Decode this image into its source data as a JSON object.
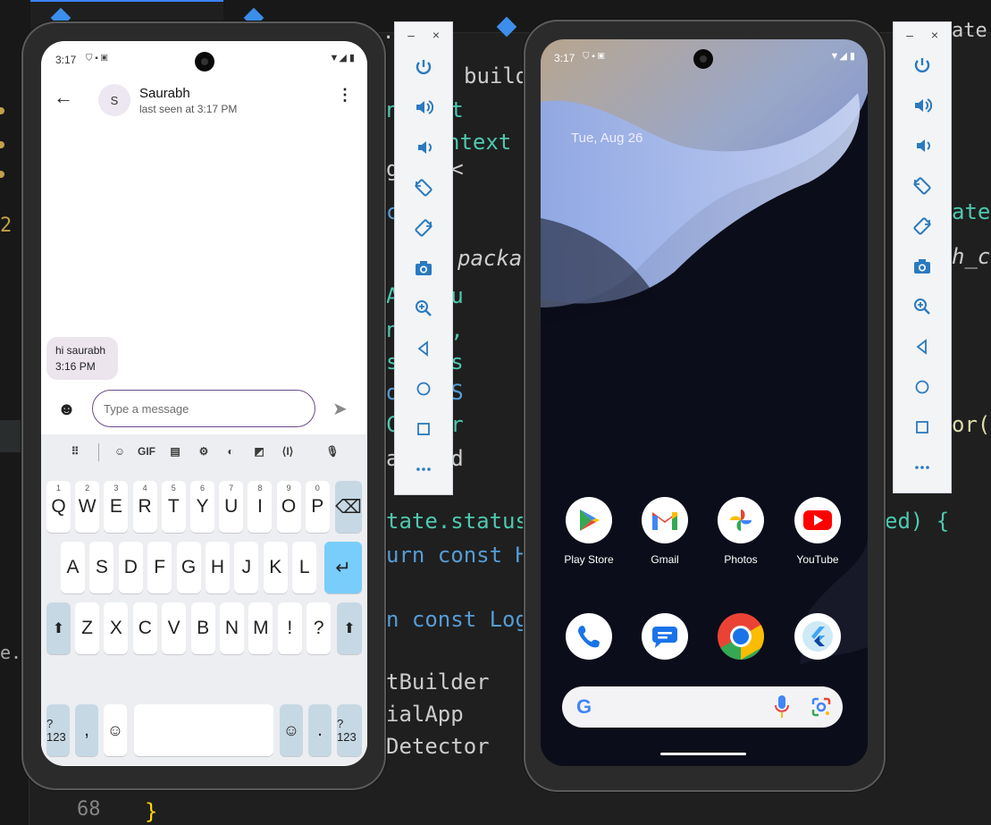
{
  "editor": {
    "gutter_line": "68",
    "gutter_num_left": "2",
    "sidebar_text": "e...",
    "tab_fragment_left": ".",
    "tab_fragment_right": "ate.d",
    "lines_left": [
      {
        "t": "build",
        "cls": "pl"
      },
      {
        "t": "nds St",
        "cls": "ty"
      },
      {
        "t": "ntext",
        "cls": "ty"
      },
      {
        "t": "getIt<",
        "cls": "pl"
      },
      {
        "t": "class",
        "cls": "kw"
      },
      {
        "t": "packag",
        "cls": "it"
      },
      {
        "t": "AuthCu",
        "cls": "ty"
      },
      {
        "t": "ntext,",
        "cls": "ty"
      },
      {
        "t": "status",
        "cls": "ty"
      },
      {
        "t": "onst S",
        "cls": "kw"
      },
      {
        "t": "Center",
        "cls": "ty"
      },
      {
        "t": "affold",
        "cls": "pl"
      },
      {
        "t": "tate.status",
        "cls": "ty"
      },
      {
        "t": "urn const H",
        "cls": "kw"
      },
      {
        "t": "n const Log",
        "cls": "kw"
      },
      {
        "t": "tBuilder",
        "cls": "pl"
      },
      {
        "t": "ialApp",
        "cls": "pl"
      },
      {
        "t": "Detector",
        "cls": "pl"
      },
      {
        "t": "}",
        "cls": "br"
      }
    ],
    "lines_right": [
      {
        "t": "ate",
        "cls": "ty"
      },
      {
        "t": "h_cu",
        "cls": "it"
      },
      {
        "t": "or(",
        "cls": "yl"
      },
      {
        "t": "ed) {",
        "cls": "ty"
      }
    ]
  },
  "emulator_controls": {
    "minimize": "–",
    "close": "×",
    "buttons": [
      "power-icon",
      "volume-up-icon",
      "volume-down-icon",
      "rotate-left-icon",
      "rotate-right-icon",
      "camera-icon",
      "zoom-icon",
      "back-icon",
      "home-icon",
      "overview-icon",
      "more-icon"
    ],
    "more_glyph": "⋯"
  },
  "chat_phone": {
    "status_time": "3:17",
    "contact_name": "Saurabh",
    "contact_initial": "S",
    "last_seen": "last seen at 3:17 PM",
    "message_text": "hi saurabh",
    "message_time": "3:16 PM",
    "input_placeholder": "Type a message",
    "keyboard": {
      "tool_gif": "GIF",
      "row1": [
        {
          "k": "Q",
          "h": "1"
        },
        {
          "k": "W",
          "h": "2"
        },
        {
          "k": "E",
          "h": "3"
        },
        {
          "k": "R",
          "h": "4"
        },
        {
          "k": "T",
          "h": "5"
        },
        {
          "k": "Y",
          "h": "6"
        },
        {
          "k": "U",
          "h": "7"
        },
        {
          "k": "I",
          "h": "8"
        },
        {
          "k": "O",
          "h": "9"
        },
        {
          "k": "P",
          "h": "0"
        }
      ],
      "row2": [
        "A",
        "S",
        "D",
        "F",
        "G",
        "H",
        "J",
        "K",
        "L"
      ],
      "row3": [
        "Z",
        "X",
        "C",
        "V",
        "B",
        "N",
        "M",
        "!",
        "?"
      ],
      "sym_label": "?123",
      "comma": ",",
      "period": ".",
      "emoji": "☺",
      "enter": "↵",
      "backspace": "⌫",
      "shift": "⬆"
    }
  },
  "home_phone": {
    "status_time": "3:17",
    "date": "Tue, Aug 26",
    "apps_row1": [
      {
        "name": "Play Store",
        "icon": "play-store-icon"
      },
      {
        "name": "Gmail",
        "icon": "gmail-icon"
      },
      {
        "name": "Photos",
        "icon": "photos-icon"
      },
      {
        "name": "YouTube",
        "icon": "youtube-icon"
      }
    ],
    "apps_row2": [
      {
        "icon": "phone-icon"
      },
      {
        "icon": "messages-icon"
      },
      {
        "icon": "chrome-icon"
      },
      {
        "icon": "flutter-icon"
      }
    ],
    "search_g": "G"
  },
  "colors": {
    "accent_purple": "#6b4a8c",
    "enter_key": "#79cdfa",
    "youtube_red": "#ff0000"
  }
}
